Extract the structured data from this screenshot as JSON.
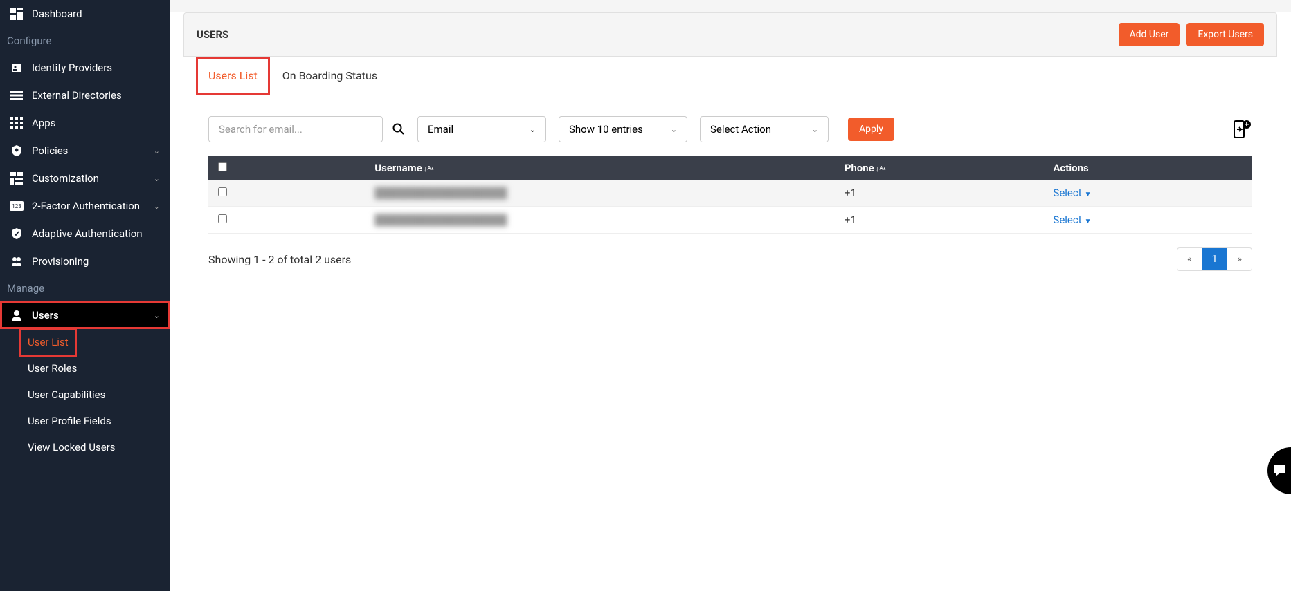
{
  "sidebar": {
    "items": [
      {
        "icon": "dashboard",
        "label": "Dashboard"
      }
    ],
    "configure_label": "Configure",
    "configure_items": [
      {
        "icon": "idp",
        "label": "Identity Providers"
      },
      {
        "icon": "extdir",
        "label": "External Directories"
      },
      {
        "icon": "apps",
        "label": "Apps"
      },
      {
        "icon": "policies",
        "label": "Policies",
        "expandable": true
      },
      {
        "icon": "custom",
        "label": "Customization",
        "expandable": true
      },
      {
        "icon": "twofa",
        "label": "2-Factor Authentication",
        "expandable": true
      },
      {
        "icon": "adaptive",
        "label": "Adaptive Authentication"
      },
      {
        "icon": "provisioning",
        "label": "Provisioning"
      }
    ],
    "manage_label": "Manage",
    "users_label": "Users",
    "users_sub": [
      {
        "label": "User List",
        "active": true
      },
      {
        "label": "User Roles"
      },
      {
        "label": "User Capabilities"
      },
      {
        "label": "User Profile Fields"
      },
      {
        "label": "View Locked Users"
      }
    ]
  },
  "header": {
    "title": "USERS",
    "add_user": "Add User",
    "export_users": "Export Users"
  },
  "tabs": [
    {
      "label": "Users List",
      "active": true
    },
    {
      "label": "On Boarding Status"
    }
  ],
  "filters": {
    "search_placeholder": "Search for email...",
    "field_dropdown": "Email",
    "entries_dropdown": "Show 10 entries",
    "action_dropdown": "Select Action",
    "apply": "Apply"
  },
  "table": {
    "headers": {
      "username": "Username",
      "phone": "Phone",
      "actions": "Actions"
    },
    "rows": [
      {
        "username": "██████████████████",
        "phone": "+1",
        "action": "Select"
      },
      {
        "username": "██████████████████",
        "phone": "+1",
        "action": "Select"
      }
    ]
  },
  "footer": {
    "count_text": "Showing 1 - 2 of total 2 users",
    "prev": "«",
    "page": "1",
    "next": "»"
  }
}
